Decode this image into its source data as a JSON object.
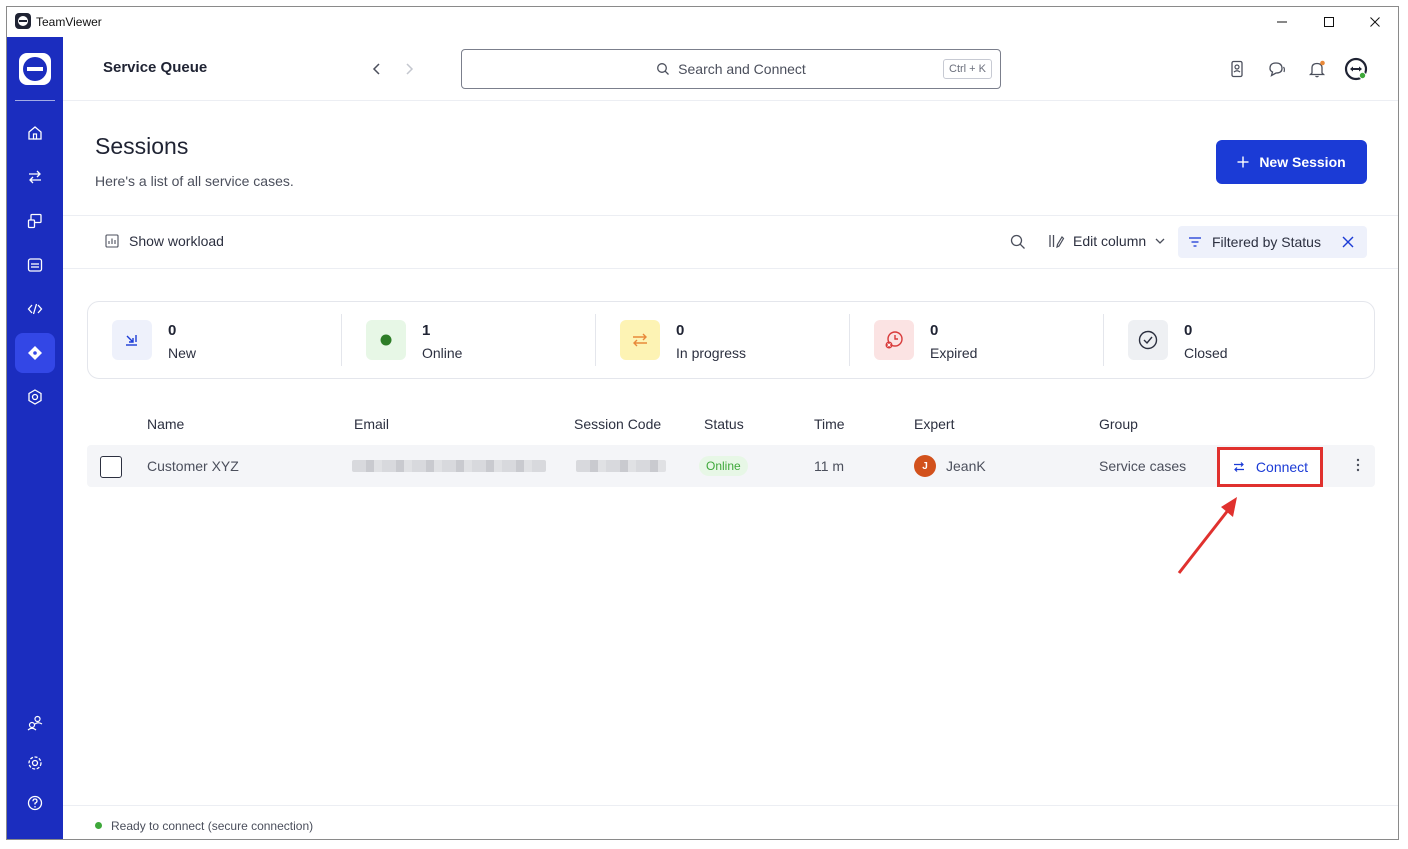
{
  "window": {
    "title": "TeamViewer",
    "controls": {
      "minimize": "—",
      "maximize": "☐",
      "close": "✕"
    }
  },
  "sidebar": {
    "items": [
      {
        "icon": "home-icon"
      },
      {
        "icon": "transfer-icon"
      },
      {
        "icon": "remote-devices-icon"
      },
      {
        "icon": "meeting-icon"
      },
      {
        "icon": "code-icon"
      },
      {
        "icon": "service-queue-icon",
        "active": true
      },
      {
        "icon": "monitoring-icon"
      }
    ],
    "bottom_items": [
      {
        "icon": "people-icon"
      },
      {
        "icon": "settings-icon"
      },
      {
        "icon": "help-icon"
      }
    ]
  },
  "header": {
    "page_heading": "Service Queue",
    "search_placeholder": "Search and Connect",
    "search_shortcut": "Ctrl + K"
  },
  "sessions": {
    "title": "Sessions",
    "subtitle": "Here's a list of all service cases.",
    "new_session_label": "New Session"
  },
  "toolbar": {
    "show_workload": "Show workload",
    "edit_column": "Edit column",
    "filter_chip": "Filtered by Status"
  },
  "stats": [
    {
      "count": "0",
      "label": "New",
      "color": "#eef1fb",
      "icon_color": "#1b3bd6"
    },
    {
      "count": "1",
      "label": "Online",
      "color": "#e7f7e6",
      "icon_color": "#2e7d27"
    },
    {
      "count": "0",
      "label": "In progress",
      "color": "#fdf3b4",
      "icon_color": "#e8893a"
    },
    {
      "count": "0",
      "label": "Expired",
      "color": "#fbe3e3",
      "icon_color": "#d83a3a"
    },
    {
      "count": "0",
      "label": "Closed",
      "color": "#eef0f3",
      "icon_color": "#2c3040"
    }
  ],
  "table": {
    "columns": [
      "Name",
      "Email",
      "Session Code",
      "Status",
      "Time",
      "Expert",
      "Group"
    ],
    "rows": [
      {
        "name": "Customer XYZ",
        "status": "Online",
        "time": "11 m",
        "expert_initial": "J",
        "expert": "JeanK",
        "group": "Service cases",
        "action": "Connect"
      }
    ]
  },
  "footer": {
    "status": "Ready to connect (secure connection)"
  },
  "colors": {
    "brand": "#1b2dbf",
    "accent": "#1b3bd6",
    "highlight": "#e0312e",
    "online": "#3ea83a"
  }
}
